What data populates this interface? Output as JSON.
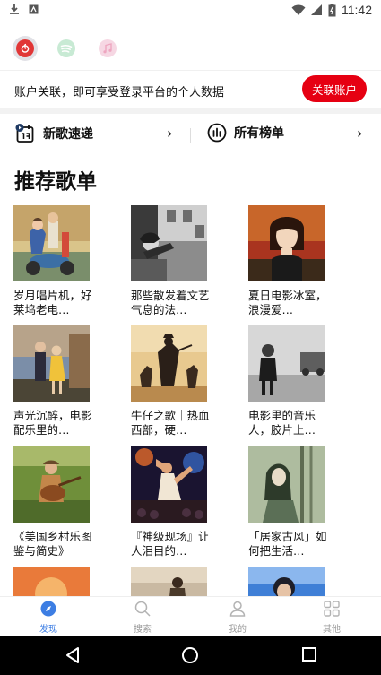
{
  "status_bar": {
    "time": "11:42",
    "left_icons": [
      "download-icon",
      "app-notification-icon"
    ],
    "right_icons": [
      "wifi-icon",
      "cell-signal-icon",
      "battery-icon"
    ]
  },
  "platforms": [
    {
      "name": "netease-music",
      "icon": "netease-icon",
      "color": "#e13737",
      "active": true
    },
    {
      "name": "spotify",
      "icon": "spotify-icon",
      "color": "#c8ead4",
      "active": false
    },
    {
      "name": "apple-music",
      "icon": "music-note-icon",
      "color": "#f2c6d8",
      "active": false
    }
  ],
  "account_bar": {
    "message": "账户关联，即可享受登录平台的个人数据",
    "button_label": "关联账户",
    "button_color": "#e60012"
  },
  "quick_entries": [
    {
      "label": "新歌速递",
      "icon": "new-songs-calendar-icon"
    },
    {
      "label": "所有榜单",
      "icon": "charts-icon"
    }
  ],
  "section_title": "推荐歌单",
  "playlists": [
    {
      "title": "岁月唱片机，好莱坞老电…",
      "cover": "vintage-scooter-couple"
    },
    {
      "title": "那些散发着文艺气息的法…",
      "cover": "bw-window-scene"
    },
    {
      "title": "夏日电影冰室，浪漫爱…",
      "cover": "amelie-portrait"
    },
    {
      "title": "声光沉醉，电影配乐里的…",
      "cover": "couple-at-dusk"
    },
    {
      "title": "牛仔之歌｜热血西部，硬…",
      "cover": "western-gunfighters"
    },
    {
      "title": "电影里的音乐人，胶片上…",
      "cover": "bw-musician-street"
    },
    {
      "title": "《美国乡村乐图鉴与简史》",
      "cover": "country-guitarist-field"
    },
    {
      "title": "『神级现场』让人泪目的…",
      "cover": "live-concert-performer"
    },
    {
      "title": "「居家古风」如何把生活…",
      "cover": "forest-girl-illustration"
    },
    {
      "title": "",
      "cover": "orange-sunset"
    },
    {
      "title": "",
      "cover": "guitarist-outdoors"
    },
    {
      "title": "",
      "cover": "blue-portrait"
    }
  ],
  "tabs": [
    {
      "label": "发现",
      "icon": "compass-icon",
      "active": true
    },
    {
      "label": "搜索",
      "icon": "search-icon",
      "active": false
    },
    {
      "label": "我的",
      "icon": "user-icon",
      "active": false
    },
    {
      "label": "其他",
      "icon": "grid-icon",
      "active": false
    }
  ],
  "system_nav": [
    "back-icon",
    "home-icon",
    "recents-icon"
  ],
  "accent_color": "#3d7ee3"
}
